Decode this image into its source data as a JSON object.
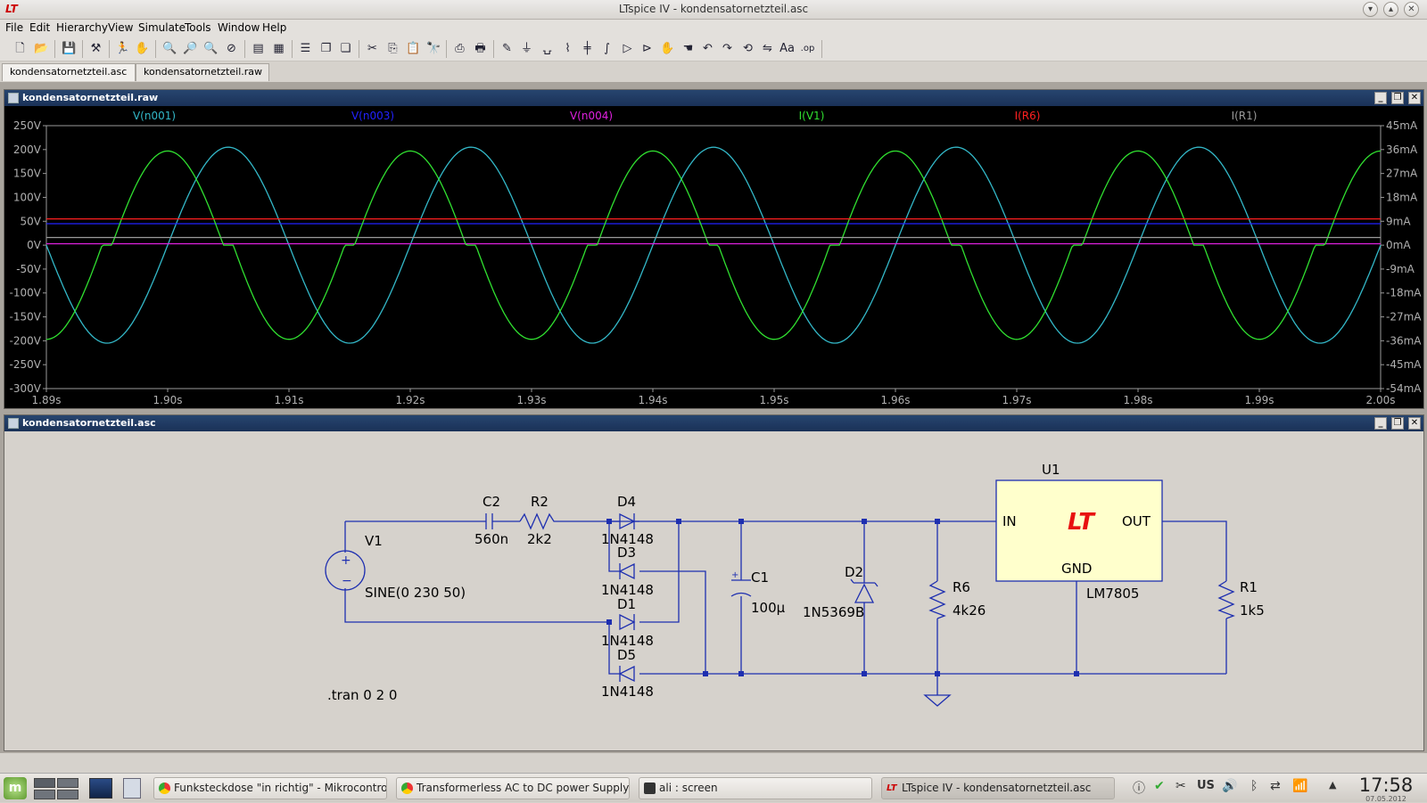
{
  "window": {
    "title": "LTspice IV - kondensatornetzteil.asc",
    "logo": "LT"
  },
  "menu": [
    "File",
    "Edit",
    "Hierarchy",
    "View",
    "Simulate",
    "Tools",
    "Window",
    "Help"
  ],
  "tabs": [
    "kondensatornetzteil.asc",
    "kondensatornetzteil.raw"
  ],
  "plot_window": {
    "title": "kondensatornetzteil.raw",
    "traces": [
      {
        "label": "V(n001)",
        "color": "#33b8c8"
      },
      {
        "label": "V(n003)",
        "color": "#2222ff"
      },
      {
        "label": "V(n004)",
        "color": "#e020e0"
      },
      {
        "label": "I(V1)",
        "color": "#30e030"
      },
      {
        "label": "I(R6)",
        "color": "#ff2020"
      },
      {
        "label": "I(R1)",
        "color": "#9a9a9a"
      }
    ]
  },
  "chart_data": {
    "type": "line",
    "x": [
      1.89,
      1.9,
      1.91,
      1.92,
      1.93,
      1.94,
      1.95,
      1.96,
      1.97,
      1.98,
      1.99,
      2.0
    ],
    "x_tick_labels": [
      "1.89s",
      "1.90s",
      "1.91s",
      "1.92s",
      "1.93s",
      "1.94s",
      "1.95s",
      "1.96s",
      "1.97s",
      "1.98s",
      "1.99s",
      "2.00s"
    ],
    "y_left_ticks": [
      "250V",
      "200V",
      "150V",
      "100V",
      "50V",
      "0V",
      "-50V",
      "-100V",
      "-150V",
      "-200V",
      "-250V",
      "-300V"
    ],
    "y_right_ticks": [
      "45mA",
      "36mA",
      "27mA",
      "18mA",
      "9mA",
      "0mA",
      "-9mA",
      "-18mA",
      "-27mA",
      "-36mA",
      "-45mA",
      "-54mA"
    ],
    "ylim_left": [
      -300,
      250
    ],
    "ylim_right": [
      -54,
      45
    ],
    "xlim": [
      1.89,
      2.0
    ],
    "series": [
      {
        "name": "V(n001)",
        "axis": "left",
        "kind": "sine",
        "amplitude": 205,
        "frequency": 50,
        "phase_deg": 0,
        "offset": 20
      },
      {
        "name": "V(n003)",
        "axis": "left",
        "kind": "dc",
        "value": 45
      },
      {
        "name": "V(n004)",
        "axis": "left",
        "kind": "dc",
        "value": 3
      },
      {
        "name": "I(V1)",
        "axis": "left",
        "kind": "clipped-sine",
        "amplitude": 197,
        "frequency": 50,
        "phase_deg": 90,
        "clip": 25
      },
      {
        "name": "I(R6)",
        "axis": "left",
        "kind": "dc",
        "value": 55
      },
      {
        "name": "I(R1)",
        "axis": "left",
        "kind": "dc",
        "value": 16
      }
    ],
    "grid": false
  },
  "schematic_window": {
    "title": "kondensatornetzteil.asc",
    "labels": {
      "v1": "V1",
      "v1_value": "SINE(0 230 50)",
      "c2": "C2",
      "c2_value": "560n",
      "r2": "R2",
      "r2_value": "2k2",
      "d4": "D4",
      "d4_value": "1N4148",
      "d3": "D3",
      "d3_value": "1N4148",
      "d1": "D1",
      "d1_value": "1N4148",
      "d5": "D5",
      "d5_value": "1N4148",
      "c1": "C1",
      "c1_value": "100µ",
      "d2": "D2",
      "d2_value": "1N5369B",
      "r6": "R6",
      "r6_value": "4k26",
      "u1": "U1",
      "u1_value": "LM7805",
      "in": "IN",
      "out": "OUT",
      "gnd": "GND",
      "r1": "R1",
      "r1_value": "1k5",
      "directive": ".tran 0 2 0",
      "lt_logo": "LT"
    }
  },
  "taskbar": {
    "tasks": [
      "Funksteckdose \"in richtig\" - Mikrocontrolle",
      "Transformerless AC to DC power Supply - C",
      "ali : screen",
      "LTspice IV - kondensatornetzteil.asc"
    ],
    "keyboard": "US",
    "time": "17:58",
    "date": "07.05.2012"
  }
}
